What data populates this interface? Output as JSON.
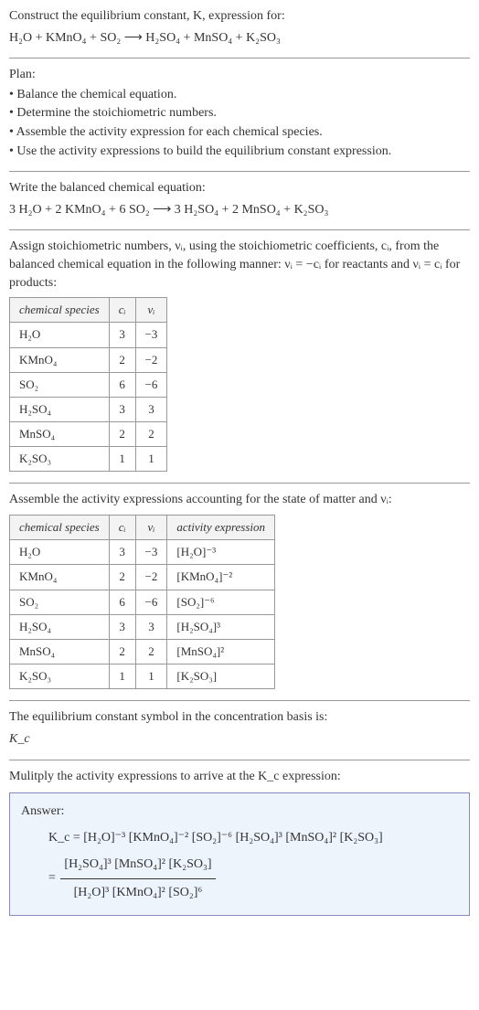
{
  "intro": "Construct the equilibrium constant, K, expression for:",
  "main_equation": "H₂O + KMnO₄ + SO₂ ⟶ H₂SO₄ + MnSO₄ + K₂SO₃",
  "plan_label": "Plan:",
  "plan_items": [
    "• Balance the chemical equation.",
    "• Determine the stoichiometric numbers.",
    "• Assemble the activity expression for each chemical species.",
    "• Use the activity expressions to build the equilibrium constant expression."
  ],
  "balanced_label": "Write the balanced chemical equation:",
  "balanced_equation": "3 H₂O + 2 KMnO₄ + 6 SO₂ ⟶ 3 H₂SO₄ + 2 MnSO₄ + K₂SO₃",
  "assign_text": "Assign stoichiometric numbers, νᵢ, using the stoichiometric coefficients, cᵢ, from the balanced chemical equation in the following manner: νᵢ = −cᵢ for reactants and νᵢ = cᵢ for products:",
  "table1_headers": [
    "chemical species",
    "cᵢ",
    "νᵢ"
  ],
  "table1_rows": [
    {
      "sp": "H₂O",
      "c": "3",
      "v": "−3"
    },
    {
      "sp": "KMnO₄",
      "c": "2",
      "v": "−2"
    },
    {
      "sp": "SO₂",
      "c": "6",
      "v": "−6"
    },
    {
      "sp": "H₂SO₄",
      "c": "3",
      "v": "3"
    },
    {
      "sp": "MnSO₄",
      "c": "2",
      "v": "2"
    },
    {
      "sp": "K₂SO₃",
      "c": "1",
      "v": "1"
    }
  ],
  "assemble_text": "Assemble the activity expressions accounting for the state of matter and νᵢ:",
  "table2_headers": [
    "chemical species",
    "cᵢ",
    "νᵢ",
    "activity expression"
  ],
  "table2_rows": [
    {
      "sp": "H₂O",
      "c": "3",
      "v": "−3",
      "a": "[H₂O]⁻³"
    },
    {
      "sp": "KMnO₄",
      "c": "2",
      "v": "−2",
      "a": "[KMnO₄]⁻²"
    },
    {
      "sp": "SO₂",
      "c": "6",
      "v": "−6",
      "a": "[SO₂]⁻⁶"
    },
    {
      "sp": "H₂SO₄",
      "c": "3",
      "v": "3",
      "a": "[H₂SO₄]³"
    },
    {
      "sp": "MnSO₄",
      "c": "2",
      "v": "2",
      "a": "[MnSO₄]²"
    },
    {
      "sp": "K₂SO₃",
      "c": "1",
      "v": "1",
      "a": "[K₂SO₃]"
    }
  ],
  "kc_symbol_text": "The equilibrium constant symbol in the concentration basis is:",
  "kc_symbol": "K_c",
  "multiply_text": "Mulitply the activity expressions to arrive at the K_c expression:",
  "answer_label": "Answer:",
  "answer_line1": "K_c = [H₂O]⁻³ [KMnO₄]⁻² [SO₂]⁻⁶ [H₂SO₄]³ [MnSO₄]² [K₂SO₃]",
  "answer_frac_num": "[H₂SO₄]³ [MnSO₄]² [K₂SO₃]",
  "answer_frac_den": "[H₂O]³ [KMnO₄]² [SO₂]⁶",
  "equals": " = "
}
